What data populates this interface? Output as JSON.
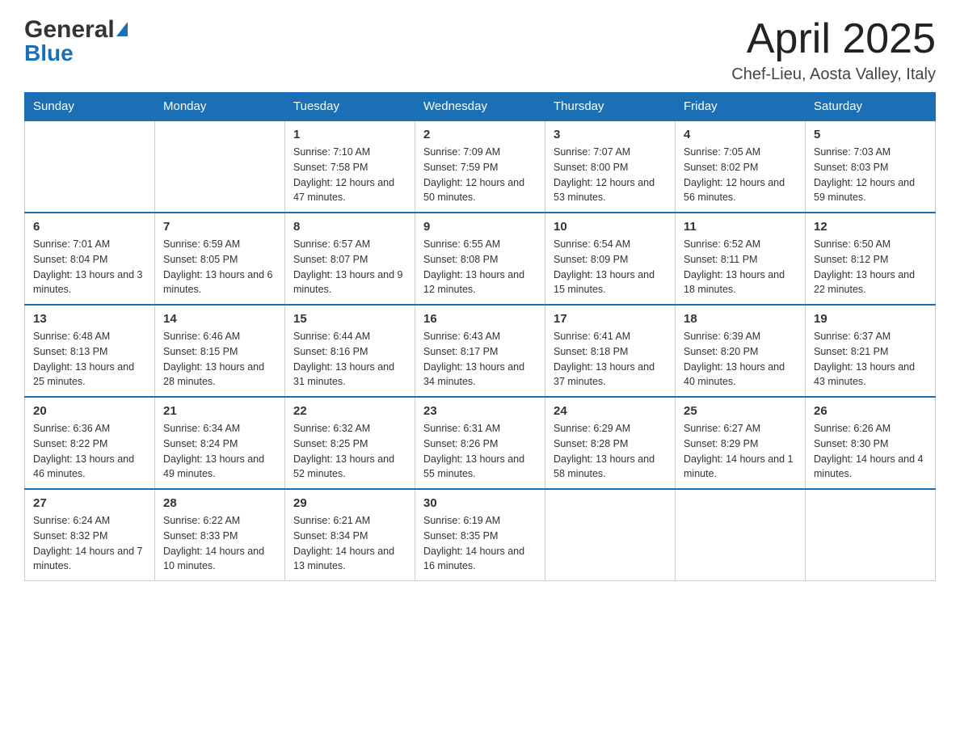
{
  "header": {
    "logo_general": "General",
    "logo_blue": "Blue",
    "month_title": "April 2025",
    "location": "Chef-Lieu, Aosta Valley, Italy"
  },
  "columns": [
    "Sunday",
    "Monday",
    "Tuesday",
    "Wednesday",
    "Thursday",
    "Friday",
    "Saturday"
  ],
  "weeks": [
    [
      {
        "day": "",
        "sunrise": "",
        "sunset": "",
        "daylight": ""
      },
      {
        "day": "",
        "sunrise": "",
        "sunset": "",
        "daylight": ""
      },
      {
        "day": "1",
        "sunrise": "Sunrise: 7:10 AM",
        "sunset": "Sunset: 7:58 PM",
        "daylight": "Daylight: 12 hours and 47 minutes."
      },
      {
        "day": "2",
        "sunrise": "Sunrise: 7:09 AM",
        "sunset": "Sunset: 7:59 PM",
        "daylight": "Daylight: 12 hours and 50 minutes."
      },
      {
        "day": "3",
        "sunrise": "Sunrise: 7:07 AM",
        "sunset": "Sunset: 8:00 PM",
        "daylight": "Daylight: 12 hours and 53 minutes."
      },
      {
        "day": "4",
        "sunrise": "Sunrise: 7:05 AM",
        "sunset": "Sunset: 8:02 PM",
        "daylight": "Daylight: 12 hours and 56 minutes."
      },
      {
        "day": "5",
        "sunrise": "Sunrise: 7:03 AM",
        "sunset": "Sunset: 8:03 PM",
        "daylight": "Daylight: 12 hours and 59 minutes."
      }
    ],
    [
      {
        "day": "6",
        "sunrise": "Sunrise: 7:01 AM",
        "sunset": "Sunset: 8:04 PM",
        "daylight": "Daylight: 13 hours and 3 minutes."
      },
      {
        "day": "7",
        "sunrise": "Sunrise: 6:59 AM",
        "sunset": "Sunset: 8:05 PM",
        "daylight": "Daylight: 13 hours and 6 minutes."
      },
      {
        "day": "8",
        "sunrise": "Sunrise: 6:57 AM",
        "sunset": "Sunset: 8:07 PM",
        "daylight": "Daylight: 13 hours and 9 minutes."
      },
      {
        "day": "9",
        "sunrise": "Sunrise: 6:55 AM",
        "sunset": "Sunset: 8:08 PM",
        "daylight": "Daylight: 13 hours and 12 minutes."
      },
      {
        "day": "10",
        "sunrise": "Sunrise: 6:54 AM",
        "sunset": "Sunset: 8:09 PM",
        "daylight": "Daylight: 13 hours and 15 minutes."
      },
      {
        "day": "11",
        "sunrise": "Sunrise: 6:52 AM",
        "sunset": "Sunset: 8:11 PM",
        "daylight": "Daylight: 13 hours and 18 minutes."
      },
      {
        "day": "12",
        "sunrise": "Sunrise: 6:50 AM",
        "sunset": "Sunset: 8:12 PM",
        "daylight": "Daylight: 13 hours and 22 minutes."
      }
    ],
    [
      {
        "day": "13",
        "sunrise": "Sunrise: 6:48 AM",
        "sunset": "Sunset: 8:13 PM",
        "daylight": "Daylight: 13 hours and 25 minutes."
      },
      {
        "day": "14",
        "sunrise": "Sunrise: 6:46 AM",
        "sunset": "Sunset: 8:15 PM",
        "daylight": "Daylight: 13 hours and 28 minutes."
      },
      {
        "day": "15",
        "sunrise": "Sunrise: 6:44 AM",
        "sunset": "Sunset: 8:16 PM",
        "daylight": "Daylight: 13 hours and 31 minutes."
      },
      {
        "day": "16",
        "sunrise": "Sunrise: 6:43 AM",
        "sunset": "Sunset: 8:17 PM",
        "daylight": "Daylight: 13 hours and 34 minutes."
      },
      {
        "day": "17",
        "sunrise": "Sunrise: 6:41 AM",
        "sunset": "Sunset: 8:18 PM",
        "daylight": "Daylight: 13 hours and 37 minutes."
      },
      {
        "day": "18",
        "sunrise": "Sunrise: 6:39 AM",
        "sunset": "Sunset: 8:20 PM",
        "daylight": "Daylight: 13 hours and 40 minutes."
      },
      {
        "day": "19",
        "sunrise": "Sunrise: 6:37 AM",
        "sunset": "Sunset: 8:21 PM",
        "daylight": "Daylight: 13 hours and 43 minutes."
      }
    ],
    [
      {
        "day": "20",
        "sunrise": "Sunrise: 6:36 AM",
        "sunset": "Sunset: 8:22 PM",
        "daylight": "Daylight: 13 hours and 46 minutes."
      },
      {
        "day": "21",
        "sunrise": "Sunrise: 6:34 AM",
        "sunset": "Sunset: 8:24 PM",
        "daylight": "Daylight: 13 hours and 49 minutes."
      },
      {
        "day": "22",
        "sunrise": "Sunrise: 6:32 AM",
        "sunset": "Sunset: 8:25 PM",
        "daylight": "Daylight: 13 hours and 52 minutes."
      },
      {
        "day": "23",
        "sunrise": "Sunrise: 6:31 AM",
        "sunset": "Sunset: 8:26 PM",
        "daylight": "Daylight: 13 hours and 55 minutes."
      },
      {
        "day": "24",
        "sunrise": "Sunrise: 6:29 AM",
        "sunset": "Sunset: 8:28 PM",
        "daylight": "Daylight: 13 hours and 58 minutes."
      },
      {
        "day": "25",
        "sunrise": "Sunrise: 6:27 AM",
        "sunset": "Sunset: 8:29 PM",
        "daylight": "Daylight: 14 hours and 1 minute."
      },
      {
        "day": "26",
        "sunrise": "Sunrise: 6:26 AM",
        "sunset": "Sunset: 8:30 PM",
        "daylight": "Daylight: 14 hours and 4 minutes."
      }
    ],
    [
      {
        "day": "27",
        "sunrise": "Sunrise: 6:24 AM",
        "sunset": "Sunset: 8:32 PM",
        "daylight": "Daylight: 14 hours and 7 minutes."
      },
      {
        "day": "28",
        "sunrise": "Sunrise: 6:22 AM",
        "sunset": "Sunset: 8:33 PM",
        "daylight": "Daylight: 14 hours and 10 minutes."
      },
      {
        "day": "29",
        "sunrise": "Sunrise: 6:21 AM",
        "sunset": "Sunset: 8:34 PM",
        "daylight": "Daylight: 14 hours and 13 minutes."
      },
      {
        "day": "30",
        "sunrise": "Sunrise: 6:19 AM",
        "sunset": "Sunset: 8:35 PM",
        "daylight": "Daylight: 14 hours and 16 minutes."
      },
      {
        "day": "",
        "sunrise": "",
        "sunset": "",
        "daylight": ""
      },
      {
        "day": "",
        "sunrise": "",
        "sunset": "",
        "daylight": ""
      },
      {
        "day": "",
        "sunrise": "",
        "sunset": "",
        "daylight": ""
      }
    ]
  ]
}
